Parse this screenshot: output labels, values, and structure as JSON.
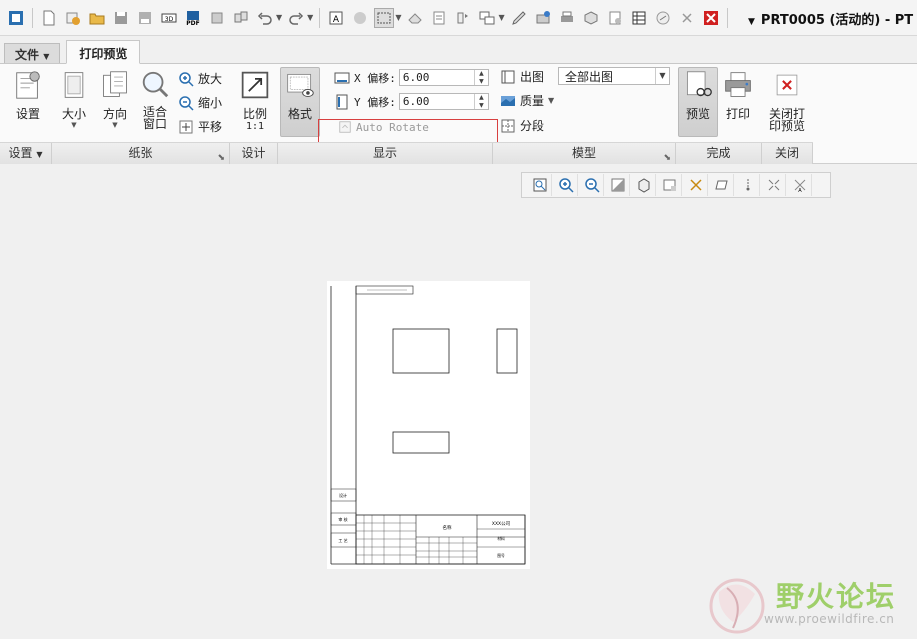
{
  "window": {
    "title": "PRT0005 (活动的) - PT"
  },
  "tabs": {
    "file": "文件",
    "active": "打印预览"
  },
  "groups": {
    "setup": "设置",
    "paper": "纸张",
    "design": "设计",
    "display": "显示",
    "model": "模型",
    "finish": "完成",
    "close": "关闭"
  },
  "buttons": {
    "setup": "设置",
    "size": "大小",
    "orientation": "方向",
    "fit_window": "适合窗口",
    "zoom_in": "放大",
    "zoom_out": "缩小",
    "pan": "平移",
    "scale": "比例",
    "scale_value": "1:1",
    "format": "格式",
    "plot": "出图",
    "quality": "质量",
    "segment": "分段",
    "preview": "预览",
    "print": "打印",
    "close_preview": "关闭打印预览"
  },
  "display": {
    "x_label": "X 偏移:",
    "x_value": "6.00",
    "y_label": "Y 偏移:",
    "y_value": "6.00",
    "auto_rotate": "Auto Rotate"
  },
  "model": {
    "plot_option": "全部出图"
  },
  "paper_labels": {
    "title_text": "XXX公司",
    "name_text": "名称",
    "material": "材料",
    "drawing_no": "图号",
    "side_a": "设计",
    "side_b": "审 核",
    "side_c": "工 艺"
  },
  "watermark": {
    "title": "野火论坛",
    "url": "www.proewildfire.cn"
  },
  "colors": {
    "accent_red": "#d84040",
    "close_icon": "#d02020",
    "watermark_green": "#9fcf6a"
  }
}
